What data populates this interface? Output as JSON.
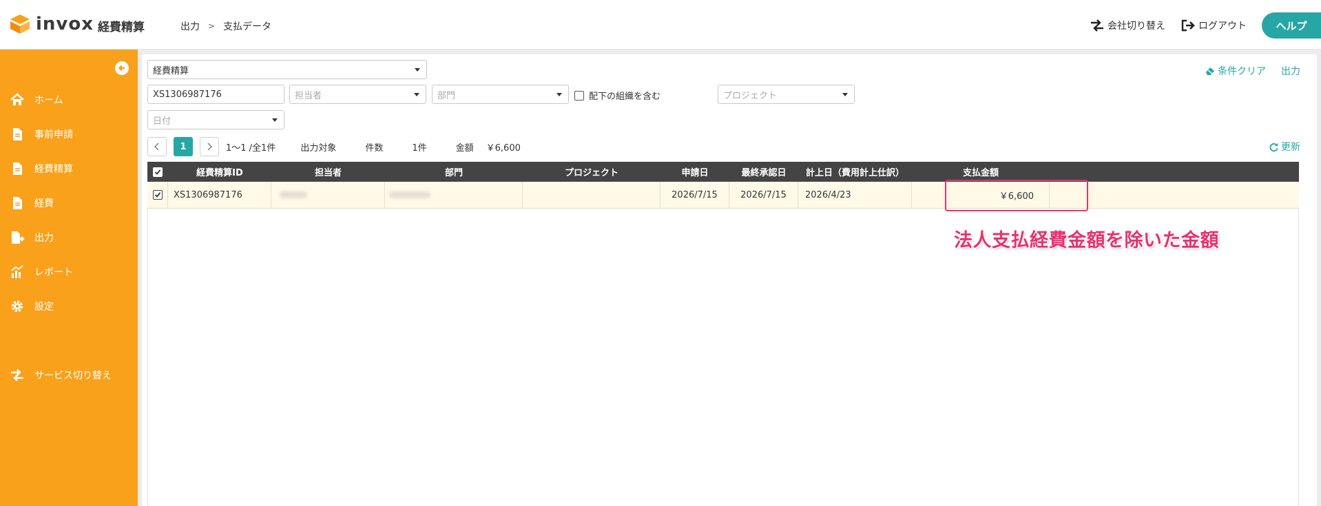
{
  "header": {
    "brand": "invox",
    "product": "経費精算",
    "breadcrumb": [
      "出力",
      "支払データ"
    ],
    "switch_company_label": "会社切り替え",
    "logout_label": "ログアウト",
    "help_label": "ヘルプ"
  },
  "sidebar": {
    "items": [
      {
        "label": "ホーム",
        "icon": "home-icon"
      },
      {
        "label": "事前申請",
        "icon": "document-icon"
      },
      {
        "label": "経費精算",
        "icon": "document-icon"
      },
      {
        "label": "経費",
        "icon": "document-icon"
      },
      {
        "label": "出力",
        "icon": "export-icon"
      },
      {
        "label": "レポート",
        "icon": "chart-icon"
      },
      {
        "label": "設定",
        "icon": "gear-icon"
      }
    ],
    "service_switch_label": "サービス切り替え"
  },
  "filters": {
    "type_value": "経費精算",
    "id_value": "XS1306987176",
    "assignee_placeholder": "担当者",
    "department_placeholder": "部門",
    "include_sub_org_label": "配下の組織を含む",
    "project_placeholder": "プロジェクト",
    "date_placeholder": "日付",
    "clear_label": "条件クリア",
    "export_label": "出力"
  },
  "pager": {
    "current_page": "1",
    "range_text": "1〜1 /全1件",
    "target_label": "出力対象",
    "count_label": "件数",
    "count_value": "1件",
    "amount_label": "金額",
    "amount_value": "￥6,600",
    "refresh_label": "更新"
  },
  "table": {
    "columns": [
      "経費精算ID",
      "担当者",
      "部門",
      "プロジェクト",
      "申請日",
      "最終承認日",
      "計上日（費用計上仕訳）",
      "支払金額"
    ],
    "rows": [
      {
        "checked": true,
        "id": "XS1306987176",
        "assignee": "",
        "department": "",
        "project": "",
        "applied": "2026/7/15",
        "approved": "2026/7/15",
        "booked": "2026/4/23",
        "amount": "￥6,600"
      }
    ]
  },
  "annotation": {
    "text": "法人支払経費金額を除いた金額",
    "color": "#e8316f"
  },
  "colors": {
    "sidebar": "#f9a11b",
    "accent": "#27a6a6",
    "table_header": "#444444",
    "row_selected": "#fff9e8"
  }
}
